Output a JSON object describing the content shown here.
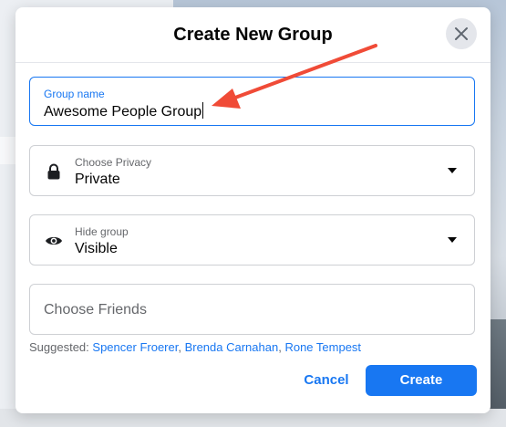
{
  "dialog": {
    "title": "Create New Group",
    "close_icon": "close-icon"
  },
  "group_name": {
    "label": "Group name",
    "value": "Awesome People Group"
  },
  "privacy": {
    "label": "Choose Privacy",
    "value": "Private",
    "icon": "lock-icon"
  },
  "visibility": {
    "label": "Hide group",
    "value": "Visible",
    "icon": "eye-icon"
  },
  "friends": {
    "placeholder": "Choose Friends"
  },
  "suggested": {
    "prefix": "Suggested:",
    "people": [
      "Spencer Froerer",
      "Brenda Carnahan",
      "Rone Tempest"
    ]
  },
  "actions": {
    "cancel_label": "Cancel",
    "create_label": "Create"
  },
  "colors": {
    "accent": "#1877f2",
    "annotation_arrow": "#f04b37"
  }
}
